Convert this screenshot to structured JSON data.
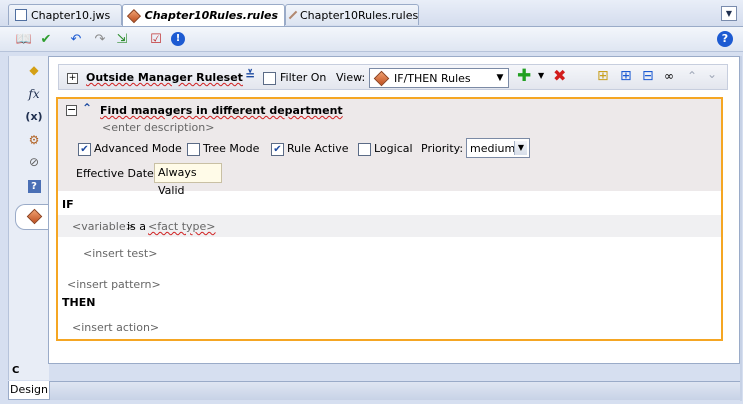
{
  "tabs": [
    {
      "label": "Chapter10.jws",
      "icon": "project-icon",
      "active": false
    },
    {
      "label": "Chapter10Rules.rules",
      "icon": "rules-icon",
      "active": true
    },
    {
      "label": "Chapter10Rules.rules",
      "icon": "rules-icon",
      "active": false
    }
  ],
  "tabmenu_icon": "dropdown-arrow-icon",
  "toolbar": {
    "icons": [
      "book-icon",
      "validate-check-icon",
      "undo-icon",
      "redo-icon",
      "export-icon",
      "test-icon",
      "info-icon"
    ],
    "help_label": "?"
  },
  "sidebar": {
    "icons": [
      "bucket-icon",
      "function-icon",
      "variable-icon",
      "links-icon",
      "decision-function-icon",
      "help-tip-icon",
      "ruleset-icon"
    ],
    "function_glyph": "fx",
    "variable_glyph": "(x)",
    "bottom_label": "C"
  },
  "ruleset": {
    "name": "Outside Manager Ruleset",
    "filter_label": "Filter On",
    "filter_checked": false,
    "view_label": "View:",
    "view_value": "IF/THEN Rules",
    "action_icons": [
      "add-icon",
      "add-dropdown-icon",
      "delete-icon",
      "expand-icon",
      "collapse-icon",
      "add-group-icon",
      "find-icon",
      "move-up-icon",
      "move-down-icon"
    ]
  },
  "rule": {
    "title": "Find managers in different department",
    "description_placeholder": "<enter description>",
    "options": [
      {
        "label": "Advanced Mode",
        "checked": true
      },
      {
        "label": "Tree Mode",
        "checked": false
      },
      {
        "label": "Rule Active",
        "checked": true
      },
      {
        "label": "Logical",
        "checked": false
      }
    ],
    "priority_label": "Priority:",
    "priority_value": "medium",
    "effective_label": "Effective Date:",
    "effective_value": "Always Valid",
    "if_label": "IF",
    "pattern_variable": "<variable>",
    "pattern_is_a": "is a",
    "pattern_fact_type": "<fact type>",
    "insert_test": "<insert test>",
    "insert_pattern": "<insert pattern>",
    "then_label": "THEN",
    "insert_action": "<insert action>"
  },
  "bottom_tabs": [
    {
      "label": "Design",
      "active": true
    }
  ],
  "colors": {
    "accent": "#f5a623",
    "delete": "#d21c1c",
    "add": "#22a022",
    "help": "#1d5bd2"
  }
}
